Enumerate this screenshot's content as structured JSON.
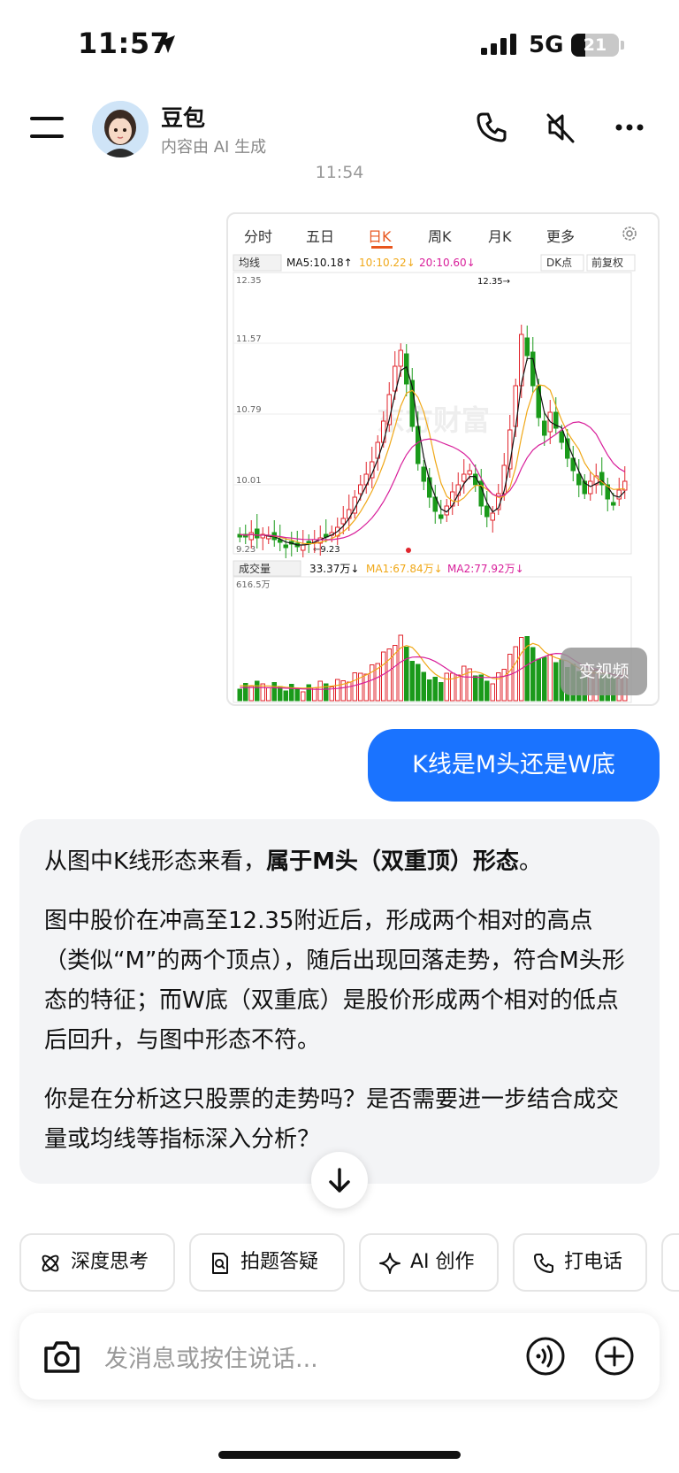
{
  "status_bar": {
    "time": "11:57",
    "network": "5G",
    "battery": "21"
  },
  "header": {
    "bot_name": "豆包",
    "subtitle": "内容由 AI 生成"
  },
  "timestamp": "11:54",
  "chart_image": {
    "tabs": [
      "分时",
      "五日",
      "日K",
      "周K",
      "月K",
      "更多"
    ],
    "active_tab": "日K",
    "ma_selector": "均线",
    "ma5_label": "MA5:10.18↑",
    "ma10_label": "10:10.22↓",
    "ma20_label": "20:10.60↓",
    "dk_label": "DK点",
    "adjust_label": "前复权",
    "price_ticks": [
      "12.35",
      "11.57",
      "10.79",
      "10.01",
      "9.23"
    ],
    "high_marker": "12.35→",
    "low_marker": "←9.23",
    "volume_selector": "成交量",
    "vol_label": "33.37万↓",
    "vol_ma1_label": "MA1:67.84万↓",
    "vol_ma2_label": "MA2:77.92万↓",
    "vol_top": "616.5万",
    "video_button": "变视频"
  },
  "user_message": "K线是M头还是W底",
  "ai_reply": {
    "p1_prefix": "从图中K线形态来看，",
    "p1_bold": "属于M头（双重顶）形态",
    "p1_suffix": "。",
    "p2": "图中股价在冲高至12.35附近后，形成两个相对的高点（类似“M”的两个顶点），随后出现回落走势，符合M头形态的特征；而W底（双重底）是股价形成两个相对的低点后回升，与图中形态不符。",
    "p3": "你是在分析这只股票的走势吗？是否需要进一步结合成交量或均线等指标深入分析？"
  },
  "quick_actions": [
    "深度思考",
    "拍题答疑",
    "AI 创作",
    "打电话"
  ],
  "input": {
    "placeholder": "发消息或按住说话..."
  },
  "colors": {
    "accent": "#1a73ff",
    "up": "#e0262d",
    "down": "#1a9a1a",
    "ma5": "#111111",
    "ma10": "#f0a818",
    "ma20": "#d81e9a"
  }
}
